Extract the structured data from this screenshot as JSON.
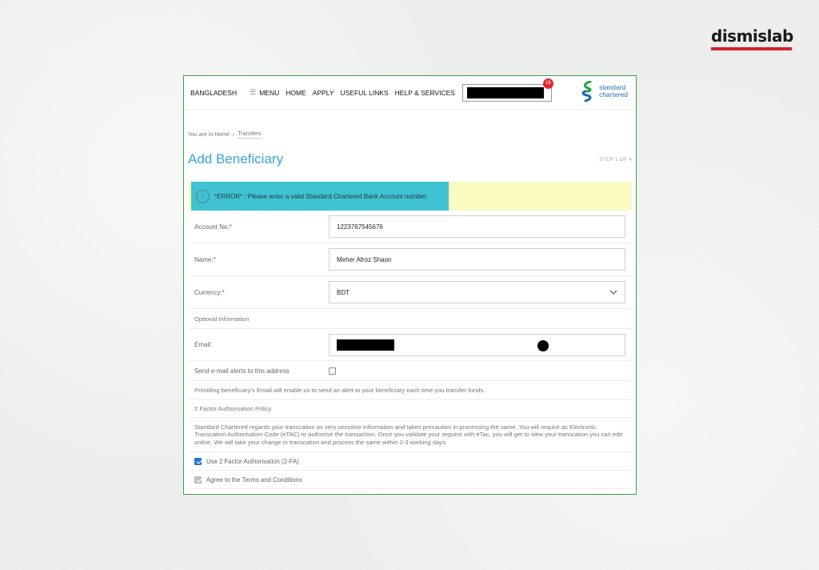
{
  "watermark": {
    "brand": "dismislab"
  },
  "header": {
    "country": "BANGLADESH",
    "nav": [
      "MENU",
      "HOME",
      "APPLY",
      "USEFUL LINKS",
      "HELP & SERVICES"
    ],
    "notification_count": "16",
    "logo": {
      "line1": "standard",
      "line2": "chartered"
    }
  },
  "breadcrumb": {
    "prefix": "You are in Home",
    "separator": "›",
    "current": "Transfers"
  },
  "page": {
    "title": "Add Beneficiary",
    "step": "STEP 1 OF 4"
  },
  "error": {
    "message": "*ERROR* : Please enter a valid Standard Chartered Bank Account number."
  },
  "form": {
    "account": {
      "label": "Account No.*",
      "value": "1223767545676"
    },
    "name": {
      "label": "Name:*",
      "value": "Meher Afroz Shaon"
    },
    "currency": {
      "label": "Currency:*",
      "value": "BDT"
    },
    "optional_heading": "Optional Information",
    "email": {
      "label": "Email:"
    },
    "send_alerts_label": "Send e-mail alerts to this address",
    "email_note": "Providing beneficiary's Email will enable us to send an alert to your beneficiary each time you transfer funds.",
    "twofa_heading": "2 Factor Authorisation Policy",
    "twofa_text": "Standard Chartered regards your transcation as very sensitive information and takes precaution in processing the same. You will require as Electronic Transcation Authorisation Code (eTAC) to authorise the transaction. Once you validate your request with eTac, you will get to view your transcation you can edit online. We will take your change in transcation and process the same within 2-3 working days.",
    "use_2fa_label": "Use 2 Factor Authorisation (2-FA)",
    "terms_label": "Agree to the Terms and Conditions"
  },
  "colors": {
    "frame_border": "#3aa04e",
    "title": "#39a3d8",
    "error_bg": "#fbfbc2",
    "error_highlight": "#3fc2d1",
    "brand_bar": "#d4202f"
  }
}
